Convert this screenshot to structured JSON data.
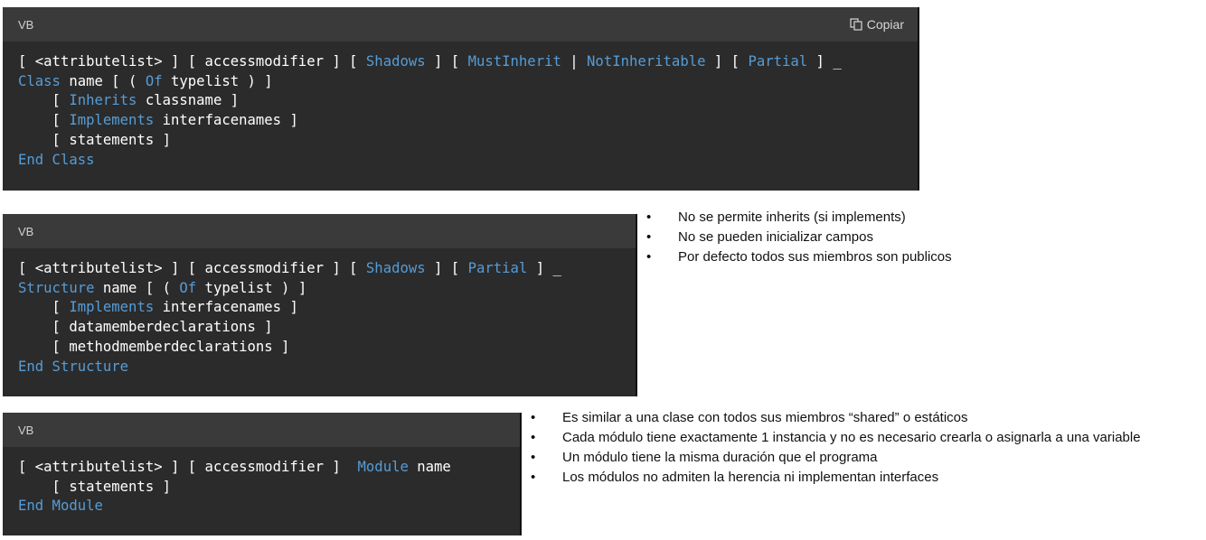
{
  "blocks": [
    {
      "language_label": "VB",
      "copy_label": "Copiar",
      "lines": [
        [
          {
            "t": "[ <attributelist> ] [ accessmodifier ] [ "
          },
          {
            "t": "Shadows",
            "k": 1
          },
          {
            "t": " ] [ "
          },
          {
            "t": "MustInherit",
            "k": 1
          },
          {
            "t": " | "
          },
          {
            "t": "NotInheritable",
            "k": 1
          },
          {
            "t": " ] [ "
          },
          {
            "t": "Partial",
            "k": 1
          },
          {
            "t": " ] _"
          }
        ],
        [
          {
            "t": "Class",
            "k": 1
          },
          {
            "t": " name [ ( "
          },
          {
            "t": "Of",
            "k": 1
          },
          {
            "t": " typelist ) ]"
          }
        ],
        [
          {
            "t": "    [ "
          },
          {
            "t": "Inherits",
            "k": 1
          },
          {
            "t": " classname ]"
          }
        ],
        [
          {
            "t": "    [ "
          },
          {
            "t": "Implements",
            "k": 1
          },
          {
            "t": " interfacenames ]"
          }
        ],
        [
          {
            "t": "    [ statements ]"
          }
        ],
        [
          {
            "t": "End Class",
            "k": 1
          }
        ]
      ]
    },
    {
      "language_label": "VB",
      "lines": [
        [
          {
            "t": "[ <attributelist> ] [ accessmodifier ] [ "
          },
          {
            "t": "Shadows",
            "k": 1
          },
          {
            "t": " ] [ "
          },
          {
            "t": "Partial",
            "k": 1
          },
          {
            "t": " ] _"
          }
        ],
        [
          {
            "t": "Structure",
            "k": 1
          },
          {
            "t": " name [ ( "
          },
          {
            "t": "Of",
            "k": 1
          },
          {
            "t": " typelist ) ]"
          }
        ],
        [
          {
            "t": "    [ "
          },
          {
            "t": "Implements",
            "k": 1
          },
          {
            "t": " interfacenames ]"
          }
        ],
        [
          {
            "t": "    [ datamemberdeclarations ]"
          }
        ],
        [
          {
            "t": "    [ methodmemberdeclarations ]"
          }
        ],
        [
          {
            "t": "End Structure",
            "k": 1
          }
        ]
      ]
    },
    {
      "language_label": "VB",
      "lines": [
        [
          {
            "t": "[ <attributelist> ] [ accessmodifier ]  "
          },
          {
            "t": "Module",
            "k": 1
          },
          {
            "t": " name"
          }
        ],
        [
          {
            "t": "    [ statements ]"
          }
        ],
        [
          {
            "t": "End Module",
            "k": 1
          }
        ]
      ]
    }
  ],
  "structure_notes": [
    "No se permite inherits (si implements)",
    "No se pueden inicializar campos",
    "Por defecto todos sus miembros son publicos"
  ],
  "module_notes": [
    "Es similar a una clase con todos sus miembros “shared” o estáticos",
    "Cada módulo tiene exactamente 1 instancia y no es necesario crearla o asignarla a una variable",
    "Un módulo tiene la misma duración que el programa",
    "Los módulos no admiten la herencia ni implementan interfaces"
  ],
  "colors": {
    "keyword": "#569cd6",
    "code_bg": "#2b2b2b",
    "header_bg": "#3a3a3a"
  },
  "icons": {
    "copy": "copy-icon"
  }
}
